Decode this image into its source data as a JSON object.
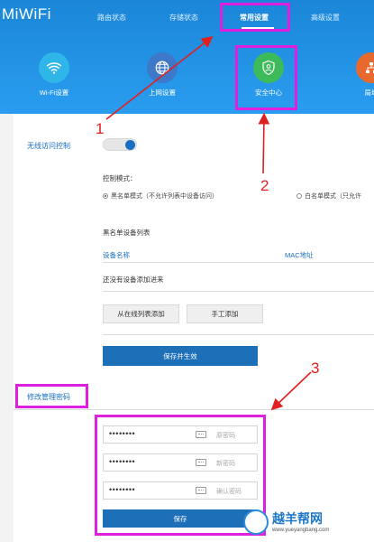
{
  "brand": "MiWiFi",
  "nav": {
    "items": [
      "路由状态",
      "存储状态",
      "常用设置",
      "高级设置"
    ],
    "active": "常用设置"
  },
  "features": [
    {
      "label": "Wi-Fi设置",
      "icon": "wifi-icon"
    },
    {
      "label": "上网设置",
      "icon": "globe-icon"
    },
    {
      "label": "安全中心",
      "icon": "shield-icon"
    },
    {
      "label": "局域",
      "icon": "lan-icon"
    }
  ],
  "wireless_access": {
    "label": "无线访问控制",
    "toggle_on": true,
    "mode_label": "控制模式：",
    "mode_blacklist": "黑名单模式（不允许列表中设备访问）",
    "mode_whitelist": "白名单模式（只允许",
    "selected_mode": "blacklist",
    "list_title": "黑名单设备列表",
    "columns": [
      "设备名称",
      "MAC地址"
    ],
    "empty_message": "还没有设备添加进来",
    "add_online_label": "从在线列表添加",
    "add_manual_label": "手工添加",
    "save_label": "保存并生效"
  },
  "admin_password": {
    "title": "修改管理密码",
    "fields": [
      {
        "value": "••••••••",
        "placeholder": "原密码"
      },
      {
        "value": "••••••••",
        "placeholder": "新密码"
      },
      {
        "value": "••••••••",
        "placeholder": "确认密码"
      }
    ],
    "save_label": "保存"
  },
  "annotations": [
    "1",
    "2",
    "3"
  ],
  "watermark": {
    "text": "越羊帮网",
    "url": "www.yueyangbang.com"
  },
  "colors": {
    "header": "#2a9df0",
    "accent": "#1d6fb8",
    "annotation_box": "#e01ee0",
    "annotation_arrow": "#e02020"
  }
}
